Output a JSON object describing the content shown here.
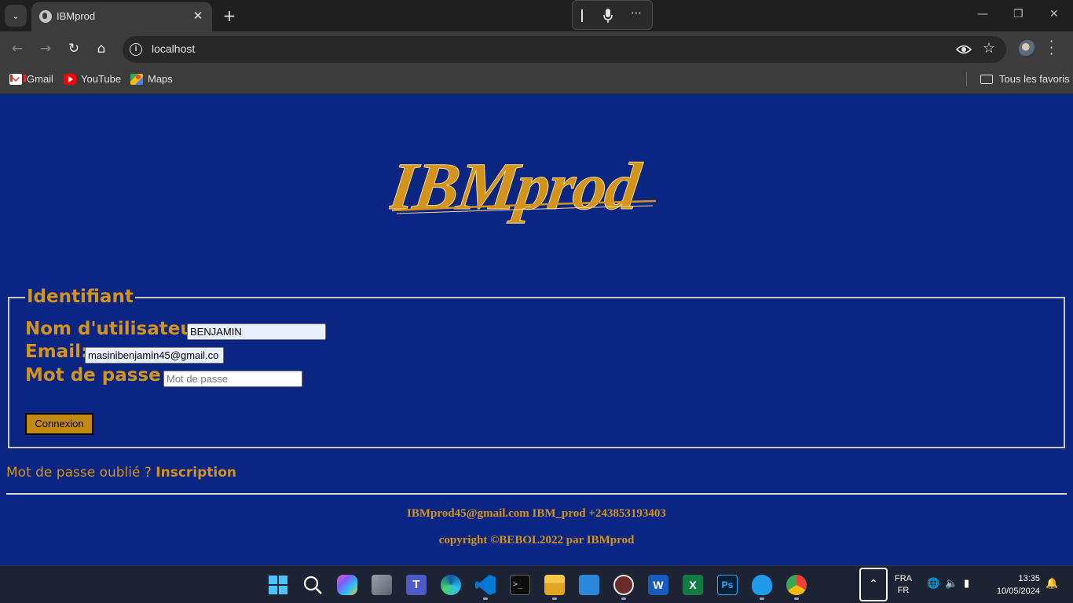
{
  "browser": {
    "tab_title": "IBMprod",
    "url": "localhost",
    "bookmarks": [
      {
        "label": "Gmail",
        "icon": "gmail-icon"
      },
      {
        "label": "YouTube",
        "icon": "youtube-icon"
      },
      {
        "label": "Maps",
        "icon": "maps-icon"
      }
    ],
    "all_bookmarks_label": "Tous les favoris"
  },
  "page": {
    "logo_text": "IBMprod",
    "legend": "Identifiant",
    "username_label": "Nom d'utilisateur:",
    "username_value": "BENJAMIN",
    "email_label": "Email:",
    "email_value": "masinibenjamin45@gmail.co",
    "password_label": "Mot de passe :",
    "password_placeholder": "Mot de passe",
    "submit_label": "Connexion",
    "forgot_text": "Mot de passe oublié ?",
    "register_link": "Inscription",
    "footer_contact": "IBMprod45@gmail.com IBM_prod +243853193403",
    "footer_copyright": "copyright ©BEBOL2022 par IBMprod"
  },
  "colors": {
    "page_background": "#0b2583",
    "accent_gold": "#d2941d",
    "button_gold": "#c28a12"
  },
  "taskbar": {
    "language_line1": "FRA",
    "language_line2": "FR",
    "time": "13:35",
    "date": "10/05/2024"
  }
}
